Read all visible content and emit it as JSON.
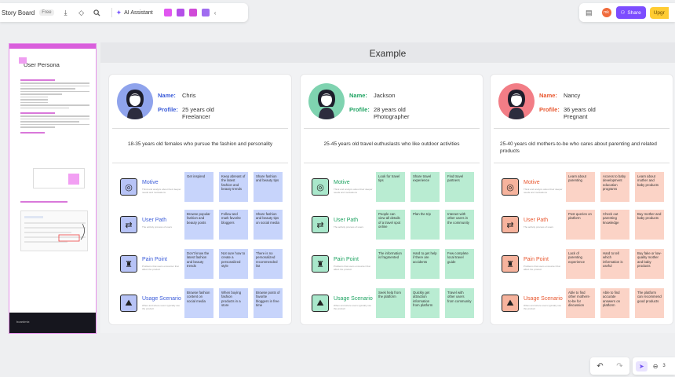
{
  "toolbar": {
    "board_title": "Story Board",
    "plan_badge": "Free",
    "ai_label": "AI Assistant",
    "share_label": "Share",
    "upgrade_label": "Upgr",
    "user_initials": "mk",
    "app_colors": [
      "#e056f0",
      "#b44fe8",
      "#d04bd8",
      "#a06cf0"
    ]
  },
  "template": {
    "title": "User Persona",
    "footer": "boardmix"
  },
  "frame": {
    "title": "Example"
  },
  "personas": [
    {
      "name": "Chris",
      "profile": [
        "25 years old",
        "Freelancer"
      ],
      "description": "18-35 years old females who pursue the fashion and personality",
      "label_color": "#3a5bd9",
      "avatar_bg": "#8fa3ec",
      "icon_bg": "#b7c3f6",
      "note_color": "#c7d4fb",
      "rows": [
        {
          "title": "Motive",
          "sub": "Think and analyze about their deeper needs and motivations",
          "notes": [
            "Get inspired",
            "Keep abreast of the latest fashion and beauty trends",
            "Share fashion and beauty tips"
          ]
        },
        {
          "title": "User Path",
          "sub": "The activity process of users",
          "notes": [
            "Browse popular fashion and beauty posts",
            "Follow and mark favorite bloggers",
            "Share fashion and beauty tips on social media"
          ]
        },
        {
          "title": "Pain Point",
          "sub": "Problems that users encounter that affect the product",
          "notes": [
            "Don't know the latest fashion and beauty trends",
            "Not sure how to create a personalized style",
            "There is no personalized recommended list"
          ]
        },
        {
          "title": "Usage Scenario",
          "sub": "When and where users typically use the product",
          "notes": [
            "Browse fashion content on social media",
            "When buying fashion products in a store",
            "Browse posts of favorite bloggers in free time"
          ]
        }
      ]
    },
    {
      "name": "Jackson",
      "profile": [
        "28 years old",
        "Photographer"
      ],
      "description": "25-45 years old travel euthuslasts who like outdoor activities",
      "label_color": "#1fa362",
      "avatar_bg": "#7fd3b0",
      "icon_bg": "#a9e7cb",
      "note_color": "#b9ecd2",
      "rows": [
        {
          "title": "Motive",
          "sub": "Think and analyze about their deeper needs and motivations",
          "notes": [
            "Look for travel tips",
            "Share travel experience",
            "Find travel partners"
          ]
        },
        {
          "title": "User Path",
          "sub": "The activity process of users",
          "notes": [
            "People can view all details of a travel spot online",
            "Plan the trip",
            "Interact with other users in the community"
          ]
        },
        {
          "title": "Pain Point",
          "sub": "Problems that users encounter that affect the product",
          "notes": [
            "The information is fragmented",
            "Hard to get help if there are accidents",
            "Few complete local travel guide"
          ]
        },
        {
          "title": "Usage Scenario",
          "sub": "When and where users typically use the product",
          "notes": [
            "Seek help from the platform",
            "Quickly get attraction information from platform",
            "Travel with other users from community"
          ]
        }
      ]
    },
    {
      "name": "Nancy",
      "profile": [
        "36 years old",
        "Pregnant"
      ],
      "description": "25-40 years old mothers-to-be who cares about parenting and related products",
      "label_color": "#e8572f",
      "avatar_bg": "#f27d86",
      "icon_bg": "#f6b39d",
      "note_color": "#fbd3c6",
      "rows": [
        {
          "title": "Motive",
          "sub": "Think and analyze about their deeper needs and motivations",
          "notes": [
            "Learn about parenting",
            "Access to baby development education programs",
            "Learn about mother and baby products"
          ]
        },
        {
          "title": "User Path",
          "sub": "The activity process of users",
          "notes": [
            "Post queries on platform",
            "Check out parenting knowledge",
            "Buy mother and baby products"
          ]
        },
        {
          "title": "Pain Point",
          "sub": "Problems that users encounter that affect the product",
          "notes": [
            "Lack of parenting experience",
            "Hard to tell which information is useful",
            "Buy fake or low-quality mother and baby products"
          ]
        },
        {
          "title": "Usage Scenario",
          "sub": "When and where users typically use the product",
          "notes": [
            "Able to find other mothers-to-be for discussion",
            "Able to find accurate answers on platform",
            "The platform can recommend good products"
          ]
        }
      ]
    }
  ],
  "labels": {
    "name": "Name:",
    "profile": "Profile:"
  },
  "bottombar": {
    "undo": "↶",
    "redo": "↷",
    "zoom": "3"
  }
}
